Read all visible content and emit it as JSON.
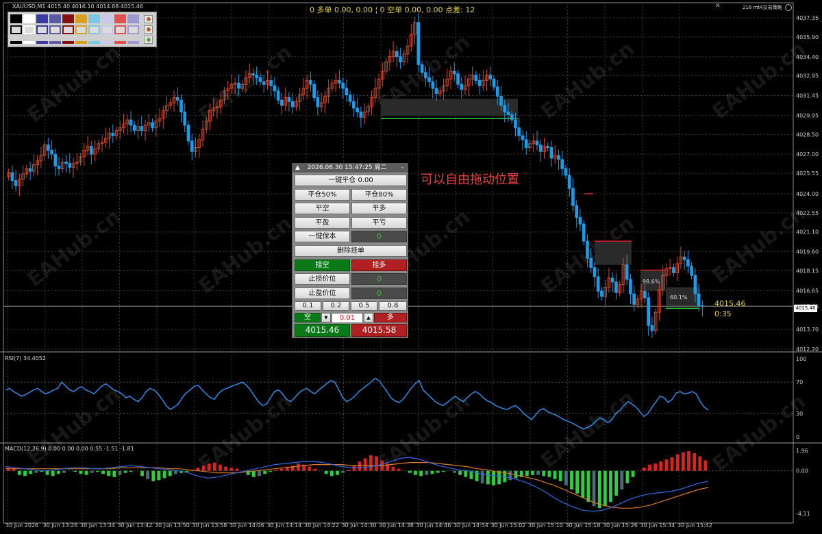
{
  "chart_header": {
    "symbol_line": "XAUUSD,M1  4015.40 4016.10 4014.68 4015.46",
    "top_info": "0 多单 0.00, 0.00 ¦ 0 空单 0.00, 0.00 点差: 12",
    "corner_text": "216 mt4交易策略",
    "window_icons": [
      "minimize-icon",
      "close-icon"
    ]
  },
  "annotation_text": "可以自由拖动位置",
  "watermark": "EAHub.cn",
  "price_axis_labels": [
    "4037.35",
    "4035.90",
    "4034.40",
    "4032.95",
    "4031.45",
    "4029.95",
    "4028.50",
    "4027.00",
    "4025.55",
    "4024.00",
    "4022.55",
    "4021.10",
    "4019.60",
    "4018.15",
    "4016.65",
    "4015.46",
    "4013.70",
    "4012.20"
  ],
  "time_axis_labels": [
    "30 Jun 2026",
    "30 Jun 13:26",
    "30 Jun 13:34",
    "30 Jun 13:42",
    "30 Jun 13:50",
    "30 Jun 13:58",
    "30 Jun 14:06",
    "30 Jun 14:14",
    "30 Jun 14:22",
    "30 Jun 14:30",
    "30 Jun 14:38",
    "30 Jun 14:46",
    "30 Jun 14:54",
    "30 Jun 15:02",
    "30 Jun 15:10",
    "30 Jun 15:18",
    "30 Jun 15:26",
    "30 Jun 15:34",
    "30 Jun 15:42"
  ],
  "current_price": "4015.46",
  "bar_timer": "0:35",
  "zone_labels": [
    "98.6%",
    "60.1%"
  ],
  "colors": {
    "bull": "#d24a2a",
    "bear": "#1a9ce8",
    "grid": "#3a3a3a",
    "rsi": "#2e8ee8",
    "macd_pos": "#e02020",
    "macd_neg": "#2ecc40",
    "macd_neg_dim": "#4a6a78",
    "signal": "#e07a20",
    "macd_line": "#2e6ee8",
    "panel_green": "#0a7a18",
    "panel_red": "#b02020",
    "accent_yellow": "#e8d23a"
  },
  "rsi": {
    "label": "RSI(7) 34.4052",
    "levels": [
      "100",
      "70",
      "30",
      "0"
    ]
  },
  "macd": {
    "label": "MACD(12,26,9) 0.00 0.00 0.00 0.55 -1.51 -1.81",
    "levels": [
      "1.96",
      "0.00",
      "-4.11"
    ]
  },
  "trade_panel": {
    "title": "2026.06.30 15:47:25 周二",
    "close_all": "一键平仓 0.00",
    "close_50": "平仓50%",
    "close_80": "平仓80%",
    "close_short": "平空",
    "close_long": "平多",
    "close_profit": "平盈",
    "close_loss": "平亏",
    "breakeven": "一键保本",
    "breakeven_value": "0",
    "delete_pending": "删除挂单",
    "pending_short": "挂空",
    "pending_long": "挂多",
    "sl_label": "止损价位",
    "sl_value": "0",
    "tp_label": "止盈价位",
    "tp_value": "0",
    "lot_presets": [
      "0.1",
      "0.2",
      "0.5",
      "0.8"
    ],
    "sell_label": "空",
    "buy_label": "多",
    "lot_value": "0.01",
    "sell_price": "4015.46",
    "buy_price": "4015.58"
  },
  "chart_data": {
    "type": "candlestick",
    "price_range": [
      4012.2,
      4037.35
    ],
    "close_series": [
      4025.6,
      4025.0,
      4024.6,
      4025.1,
      4025.5,
      4025.9,
      4025.7,
      4026.2,
      4026.5,
      4026.9,
      4027.7,
      4027.3,
      4027.0,
      4026.1,
      4025.9,
      4026.4,
      4026.3,
      4026.0,
      4026.3,
      4026.4,
      4026.8,
      4027.3,
      4027.6,
      4027.0,
      4027.4,
      4027.8,
      4027.9,
      4028.2,
      4028.6,
      4028.4,
      4028.8,
      4029.0,
      4029.3,
      4029.6,
      4029.2,
      4028.8,
      4029.1,
      4028.8,
      4029.2,
      4029.4,
      4029.0,
      4029.5,
      4029.7,
      4030.3,
      4030.7,
      4030.9,
      4031.3,
      4031.1,
      4030.2,
      4029.2,
      4028.0,
      4027.2,
      4027.5,
      4028.1,
      4028.9,
      4029.5,
      4030.3,
      4030.5,
      4030.6,
      4031.1,
      4031.8,
      4032.0,
      4032.3,
      4032.4,
      4032.0,
      4032.3,
      4032.8,
      4033.1,
      4033.0,
      4032.8,
      4032.5,
      4032.3,
      4032.6,
      4032.2,
      4031.8,
      4031.1,
      4030.7,
      4031.3,
      4031.0,
      4030.6,
      4031.0,
      4031.5,
      4032.0,
      4032.6,
      4032.3,
      4031.3,
      4030.6,
      4030.9,
      4031.4,
      4032.0,
      4032.4,
      4032.6,
      4032.4,
      4032.0,
      4031.5,
      4031.0,
      4030.5,
      4030.2,
      4029.8,
      4030.2,
      4030.6,
      4031.3,
      4032.0,
      4032.7,
      4033.3,
      4034.0,
      4034.4,
      4034.8,
      4034.4,
      4034.0,
      4034.6,
      4035.2,
      4036.1,
      4037.0,
      4033.8,
      4033.2,
      4032.8,
      4032.5,
      4032.0,
      4031.6,
      4031.8,
      4032.2,
      4032.7,
      4033.3,
      4033.1,
      4032.3,
      4031.9,
      4032.2,
      4032.7,
      4033.0,
      4032.6,
      4032.2,
      4032.6,
      4033.0,
      4032.7,
      4032.1,
      4031.4,
      4030.7,
      4030.2,
      4030.0,
      4029.6,
      4029.0,
      4028.4,
      4028.1,
      4027.5,
      4027.8,
      4028.0,
      4027.7,
      4027.2,
      4027.6,
      4027.5,
      4026.7,
      4026.9,
      4026.6,
      4025.9,
      4025.4,
      4024.4,
      4023.1,
      4022.2,
      4021.7,
      4020.4,
      4019.1,
      4018.4,
      4017.7,
      4016.6,
      4016.2,
      4016.9,
      4017.6,
      4017.3,
      4016.5,
      4017.1,
      4018.6,
      4017.5,
      4016.4,
      4015.6,
      4016.0,
      4016.6,
      4016.1,
      4014.0,
      4013.6,
      4015.0,
      4016.7,
      4017.8,
      4018.3,
      4018.4,
      4018.0,
      4018.7,
      4019.2,
      4019.0,
      4018.5,
      4017.8,
      4016.4,
      4015.5,
      4015.46
    ],
    "rsi_series": [
      60,
      62,
      58,
      55,
      52,
      54,
      57,
      60,
      62,
      58,
      55,
      57,
      60,
      62,
      70,
      65,
      60,
      58,
      62,
      64,
      60,
      58,
      55,
      60,
      65,
      68,
      64,
      60,
      58,
      55,
      50,
      52,
      48,
      45,
      50,
      58,
      62,
      60,
      55,
      48,
      40,
      35,
      38,
      42,
      50,
      56,
      60,
      65,
      66,
      60,
      55,
      50,
      48,
      55,
      60,
      62,
      64,
      66,
      68,
      70,
      66,
      60,
      52,
      45,
      40,
      42,
      50,
      58,
      60,
      55,
      48,
      45,
      50,
      56,
      60,
      62,
      58,
      55,
      60,
      64,
      68,
      72,
      70,
      60,
      50,
      45,
      48,
      52,
      58,
      62,
      66,
      70,
      75,
      72,
      65,
      58,
      50,
      46,
      44,
      48,
      55,
      62,
      68,
      72,
      60,
      55,
      50,
      45,
      42,
      40,
      44,
      48,
      52,
      48,
      45,
      50,
      55,
      58,
      55,
      50,
      46,
      44,
      40,
      38,
      36,
      35,
      38,
      40,
      36,
      30,
      26,
      22,
      28,
      34,
      36,
      32,
      30,
      28,
      25,
      22,
      20,
      18,
      15,
      12,
      10,
      12,
      15,
      20,
      24,
      22,
      18,
      22,
      30,
      34,
      40,
      45,
      42,
      38,
      32,
      26,
      30,
      38,
      45,
      52,
      50,
      44,
      48,
      56,
      58,
      55,
      56,
      58,
      55,
      45,
      38,
      34.4
    ],
    "macd_hist": [
      0.3,
      0.2,
      -0.4,
      -0.5,
      -0.3,
      -0.2,
      -0.1,
      -0.4,
      -0.5,
      -0.3,
      -0.2,
      0.0,
      -0.1,
      -0.3,
      -0.4,
      -0.2,
      -0.1,
      -0.3,
      -0.5,
      -0.6,
      -0.4,
      -0.2,
      -0.1,
      0.0,
      -0.5,
      -0.8,
      -1.0,
      -0.9,
      -0.7,
      -0.5,
      -0.3,
      -0.2,
      -0.1,
      0.1,
      0.3,
      0.5,
      0.7,
      0.8,
      0.6,
      0.4,
      0.3,
      0.2,
      0.0,
      -0.4,
      -0.6,
      -0.5,
      -0.3,
      -0.1,
      0.1,
      0.2,
      0.4,
      0.5,
      0.7,
      0.6,
      0.4,
      0.2,
      0.0,
      -0.3,
      -0.5,
      -0.4,
      -0.2,
      0.1,
      0.5,
      0.9,
      1.2,
      1.5,
      1.4,
      1.0,
      0.7,
      0.4,
      0.2,
      0.0,
      -0.2,
      -0.4,
      -0.5,
      -0.4,
      -0.3,
      -0.2,
      -0.1,
      0.0,
      -0.2,
      -0.4,
      -0.6,
      -0.8,
      -1.0,
      -1.2,
      -1.3,
      -1.4,
      -1.3,
      -1.1,
      -0.9,
      -0.7,
      -0.6,
      -0.5,
      -0.4,
      -0.4,
      -0.5,
      -0.6,
      -0.8,
      -1.0,
      -1.4,
      -1.8,
      -2.2,
      -2.6,
      -3.0,
      -3.4,
      -3.6,
      -3.4,
      -3.0,
      -2.4,
      -1.8,
      -1.2,
      -0.6,
      0.0,
      0.3,
      0.6,
      0.7,
      0.9,
      1.1,
      1.3,
      1.6,
      1.8,
      1.9,
      1.7,
      1.4,
      1.0
    ],
    "macd_line": [
      0.4,
      0.3,
      0.2,
      0.1,
      0.0,
      0.1,
      0.2,
      0.3,
      0.3,
      0.2,
      0.2,
      0.3,
      0.4,
      0.5,
      0.4,
      0.3,
      0.2,
      0.1,
      0.0,
      -0.2,
      -0.5,
      -0.7,
      -0.6,
      -0.4,
      -0.2,
      0.0,
      0.2,
      0.4,
      0.6,
      0.7,
      0.8,
      0.9,
      0.9,
      0.8,
      0.6,
      0.4,
      0.3,
      0.3,
      0.4,
      0.6,
      0.9,
      1.2,
      1.3,
      1.1,
      0.8,
      0.5,
      0.3,
      0.1,
      0.0,
      -0.2,
      -0.4,
      -0.5,
      -0.6,
      -0.8,
      -1.1,
      -1.5,
      -2.0,
      -2.6,
      -3.1,
      -3.5,
      -3.8,
      -3.9,
      -3.8,
      -3.5,
      -3.1,
      -2.7,
      -2.4,
      -2.2,
      -2.1,
      -2.0,
      -1.8,
      -1.5,
      -1.2,
      -1.0
    ],
    "signal_line": [
      0.2,
      0.2,
      0.2,
      0.2,
      0.2,
      0.2,
      0.2,
      0.2,
      0.2,
      0.2,
      0.2,
      0.2,
      0.3,
      0.3,
      0.3,
      0.3,
      0.3,
      0.2,
      0.2,
      0.1,
      0.0,
      -0.1,
      -0.2,
      -0.2,
      -0.2,
      -0.1,
      0.0,
      0.1,
      0.2,
      0.3,
      0.4,
      0.5,
      0.6,
      0.6,
      0.6,
      0.6,
      0.5,
      0.5,
      0.5,
      0.5,
      0.6,
      0.7,
      0.8,
      0.8,
      0.8,
      0.7,
      0.6,
      0.5,
      0.4,
      0.2,
      0.1,
      -0.1,
      -0.2,
      -0.4,
      -0.6,
      -0.8,
      -1.1,
      -1.4,
      -1.8,
      -2.2,
      -2.6,
      -3.0,
      -3.3,
      -3.5,
      -3.6,
      -3.6,
      -3.5,
      -3.3,
      -3.0,
      -2.7,
      -2.4,
      -2.1,
      -1.8,
      -1.6
    ]
  }
}
